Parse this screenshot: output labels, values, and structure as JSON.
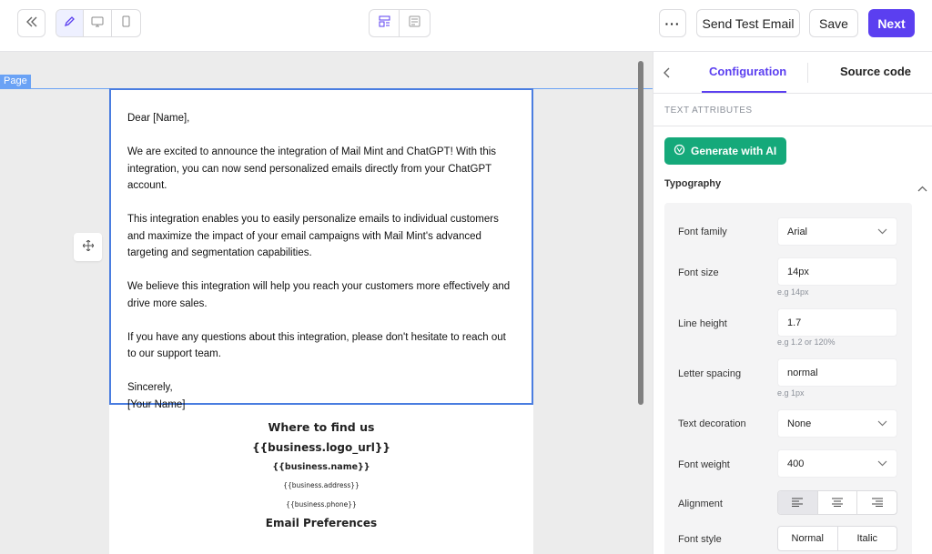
{
  "toolbar": {
    "back_icon": "double-chevron-left-icon",
    "modes": [
      {
        "name": "edit",
        "icon": "pencil-icon",
        "active": true
      },
      {
        "name": "desktop",
        "icon": "desktop-icon",
        "active": false
      },
      {
        "name": "mobile",
        "icon": "mobile-icon",
        "active": false
      }
    ],
    "views": [
      {
        "name": "layout",
        "icon": "layout-icon"
      },
      {
        "name": "notes",
        "icon": "notes-icon"
      }
    ],
    "more_label": "···",
    "send_test_label": "Send Test Email",
    "save_label": "Save",
    "next_label": "Next",
    "accent_color": "#5b3ff0"
  },
  "canvas": {
    "page_tag": "Page",
    "email": {
      "paragraphs": [
        "Dear [Name],",
        "We are excited to announce the integration of Mail Mint and ChatGPT! With this integration, you can now send personalized emails directly from your ChatGPT account.",
        "This integration enables you to easily personalize emails to individual customers and maximize the impact of your email campaigns with Mail Mint's advanced targeting and segmentation capabilities.",
        "We believe this integration will help you reach your customers more effectively and drive more sales.",
        "If you have any questions about this integration, please don't hesitate to reach out to our support team.",
        "Sincerely,\n[Your Name]"
      ],
      "footer": {
        "heading": "Where to find us",
        "logo": "{{business.logo_url}}",
        "name": "{{business.name}}",
        "address": "{{business.address}}",
        "phone": "{{business.phone}}",
        "preferences": "Email Preferences"
      }
    }
  },
  "panel": {
    "tabs": [
      {
        "label": "Configuration",
        "active": true
      },
      {
        "label": "Source code",
        "active": false
      }
    ],
    "section_title": "TEXT ATTRIBUTES",
    "generate_label": "Generate with AI",
    "generate_color": "#15a97a",
    "typography_title": "Typography",
    "fields": {
      "font_family": {
        "label": "Font family",
        "value": "Arial"
      },
      "font_size": {
        "label": "Font size",
        "value": "14px",
        "hint": "e.g 14px"
      },
      "line_height": {
        "label": "Line height",
        "value": "1.7",
        "hint": "e.g 1.2 or 120%"
      },
      "letter_spacing": {
        "label": "Letter spacing",
        "value": "normal",
        "hint": "e.g 1px"
      },
      "text_decoration": {
        "label": "Text decoration",
        "value": "None"
      },
      "font_weight": {
        "label": "Font weight",
        "value": "400"
      },
      "alignment": {
        "label": "Alignment",
        "selected": "left"
      },
      "font_style": {
        "label": "Font style",
        "options": [
          "Normal",
          "Italic"
        ]
      }
    }
  }
}
